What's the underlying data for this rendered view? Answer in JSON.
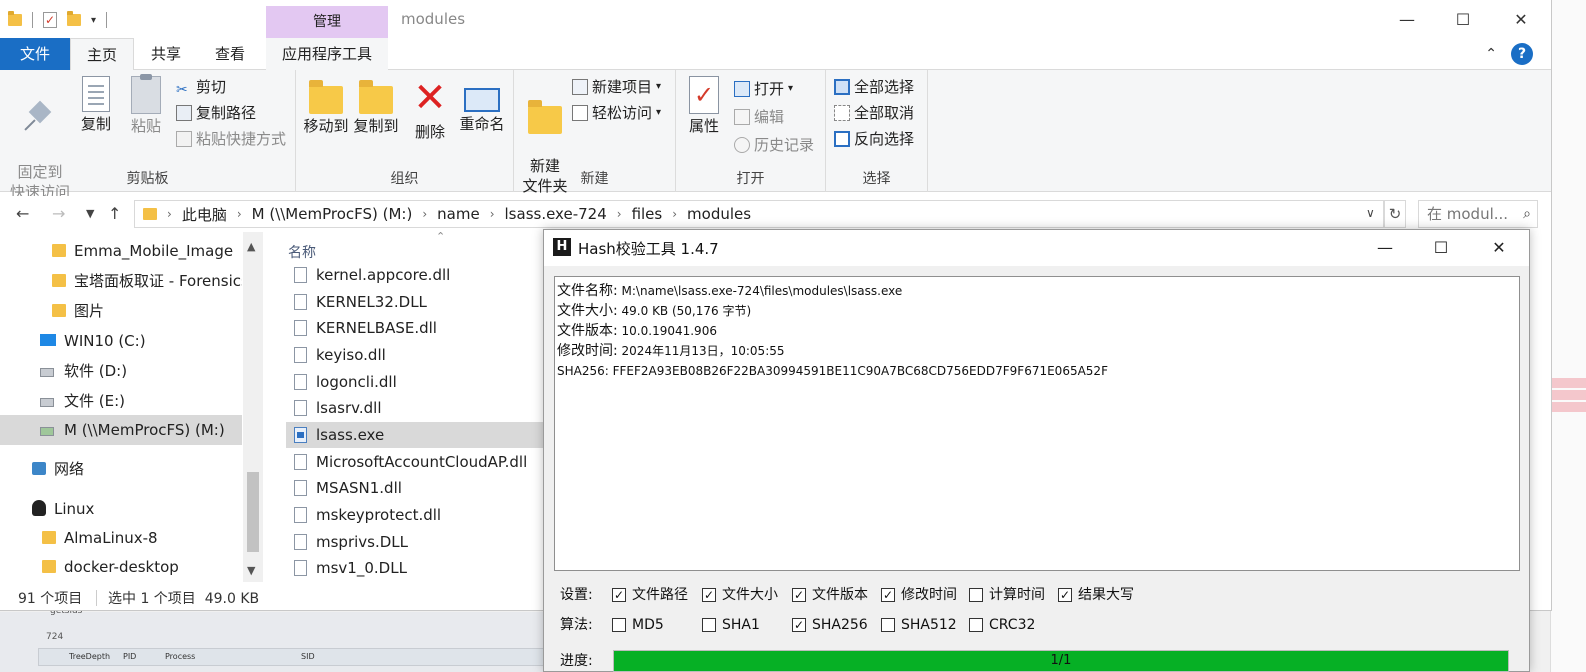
{
  "explorer": {
    "title": "modules",
    "context_tab_header": "管理",
    "window_controls": {
      "minimize": "—",
      "maximize": "☐",
      "close": "✕"
    },
    "ribbon_tabs": {
      "file": "文件",
      "home": "主页",
      "share": "共享",
      "view": "查看",
      "app_tools": "应用程序工具"
    },
    "ribbon": {
      "clipboard": {
        "label": "剪贴板",
        "pin": "固定到\n快速访问",
        "copy": "复制",
        "paste": "粘贴",
        "cut": "剪切",
        "copy_path": "复制路径",
        "paste_shortcut": "粘贴快捷方式"
      },
      "organize": {
        "label": "组织",
        "move_to": "移动到",
        "copy_to": "复制到",
        "delete": "删除",
        "rename": "重命名"
      },
      "new": {
        "label": "新建",
        "new_folder": "新建\n文件夹",
        "new_item": "新建项目",
        "easy_access": "轻松访问"
      },
      "open": {
        "label": "打开",
        "properties": "属性",
        "open": "打开",
        "edit": "编辑",
        "history": "历史记录"
      },
      "select": {
        "label": "选择",
        "select_all": "全部选择",
        "select_none": "全部取消",
        "invert": "反向选择"
      }
    },
    "address": {
      "crumbs": [
        "此电脑",
        "M (\\\\MemProcFS) (M:)",
        "name",
        "lsass.exe-724",
        "files",
        "modules"
      ],
      "search_placeholder": "在 modul..."
    },
    "nav_pane": [
      {
        "label": "Emma_Mobile_Image",
        "icon": "folder-icon"
      },
      {
        "label": "宝塔面板取证 - Forensics",
        "icon": "folder-icon"
      },
      {
        "label": "图片",
        "icon": "folder-icon"
      },
      {
        "label": "WIN10 (C:)",
        "icon": "windows-drive-icon"
      },
      {
        "label": "软件 (D:)",
        "icon": "drive-icon"
      },
      {
        "label": "文件 (E:)",
        "icon": "drive-icon"
      },
      {
        "label": "M (\\\\MemProcFS) (M:)",
        "icon": "network-drive-icon",
        "selected": true
      },
      {
        "label": "网络",
        "icon": "network-icon"
      },
      {
        "label": "Linux",
        "icon": "linux-icon"
      },
      {
        "label": "AlmaLinux-8",
        "icon": "folder-icon"
      },
      {
        "label": "docker-desktop",
        "icon": "folder-icon"
      }
    ],
    "file_list": {
      "column_name": "名称",
      "items": [
        "kernel.appcore.dll",
        "KERNEL32.DLL",
        "KERNELBASE.dll",
        "keyiso.dll",
        "logoncli.dll",
        "lsasrv.dll",
        "lsass.exe",
        "MicrosoftAccountCloudAP.dll",
        "MSASN1.dll",
        "mskeyprotect.dll",
        "msprivs.DLL",
        "msv1_0.DLL"
      ],
      "selected": "lsass.exe"
    },
    "status": {
      "count": "91 个项目",
      "selection": "选中 1 个项目  49.0 KB"
    }
  },
  "hash_tool": {
    "title": "Hash校验工具 1.4.7",
    "window_controls": {
      "minimize": "—",
      "maximize": "☐",
      "close": "✕"
    },
    "result": {
      "name_key": "文件名称:",
      "name_val": " M:\\name\\lsass.exe-724\\files\\modules\\lsass.exe",
      "size_key": "文件大小:",
      "size_val": " 49.0 KB (50,176 字节)",
      "version_key": "文件版本:",
      "version_val": " 10.0.19041.906",
      "mtime_key": "修改时间:",
      "mtime_val": " 2024年11月13日，10:05:55",
      "sha256_line": "SHA256: FFEF2A93EB08B26F22BA30994591BE11C90A7BC68CD756EDD7F9F671E065A52F"
    },
    "settings_label": "设置:",
    "settings": [
      {
        "label": "文件路径",
        "checked": true
      },
      {
        "label": "文件大小",
        "checked": true
      },
      {
        "label": "文件版本",
        "checked": true
      },
      {
        "label": "修改时间",
        "checked": true
      },
      {
        "label": "计算时间",
        "checked": false
      },
      {
        "label": "结果大写",
        "checked": true
      }
    ],
    "algo_label": "算法:",
    "algorithms": [
      {
        "label": "MD5",
        "checked": false
      },
      {
        "label": "SHA1",
        "checked": false
      },
      {
        "label": "SHA256",
        "checked": true
      },
      {
        "label": "SHA512",
        "checked": false
      },
      {
        "label": "CRC32",
        "checked": false
      }
    ],
    "progress_label": "进度:",
    "progress_text": "1/1",
    "progress_fraction": 1.0,
    "progress_color": "#06b025"
  },
  "background": {
    "labels": [
      "getsids",
      "724"
    ],
    "table_headers": [
      "TreeDepth",
      "PID",
      "Process",
      "SID"
    ]
  }
}
